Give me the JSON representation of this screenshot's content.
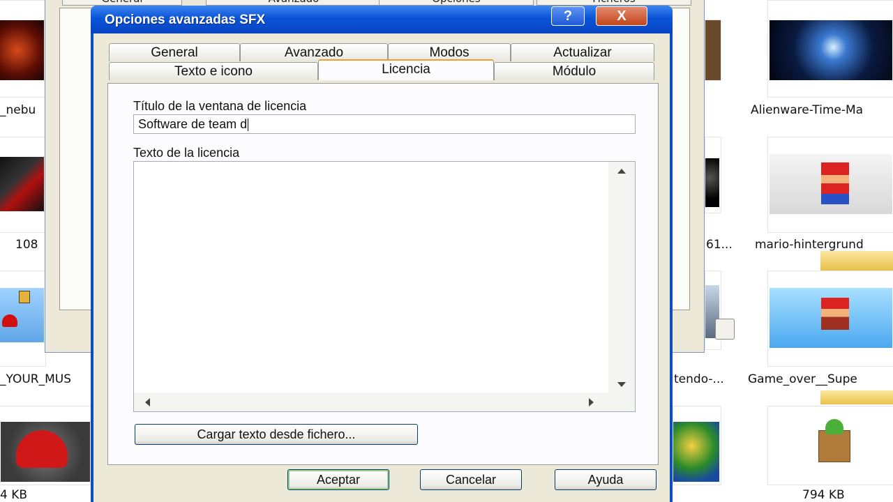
{
  "dialog": {
    "title": "Opciones avanzadas SFX",
    "help_glyph": "?",
    "close_glyph": "X",
    "tabs_row1": [
      "General",
      "Avanzado",
      "Modos",
      "Actualizar"
    ],
    "tabs_row2": [
      "Texto e icono",
      "Licencia",
      "Módulo"
    ],
    "active_tab": "Licencia",
    "license_title_label": "Título de la ventana de licencia",
    "license_title_value": "Software de team d",
    "license_text_label": "Texto de la licencia",
    "license_text_value": "",
    "load_button": "Cargar texto desde fichero...",
    "ok_button": "Aceptar",
    "cancel_button": "Cancelar",
    "help_button": "Ayuda"
  },
  "behind_window": {
    "tabs": [
      "General",
      "Avanzado",
      "Opciones",
      "Ficheros"
    ]
  },
  "explorer": {
    "files": [
      {
        "name": "_nebu",
        "icon": "nebula-thumb"
      },
      {
        "name": "Alienware-Time-Ma",
        "icon": "alienware-thumb"
      },
      {
        "name": "108",
        "icon": "game-thumb"
      },
      {
        "name": "61...",
        "icon": "thumb"
      },
      {
        "name": "mario-hintergrund",
        "icon": "mario-thumb"
      },
      {
        "name": "_YOUR_MUS",
        "icon": "mushroom-thumb"
      },
      {
        "name": "tendo-...",
        "icon": "thumb"
      },
      {
        "name": "Game_over__Supe",
        "icon": "gameover-thumb"
      }
    ],
    "sizes": [
      "4 KB",
      "794 KB"
    ]
  }
}
